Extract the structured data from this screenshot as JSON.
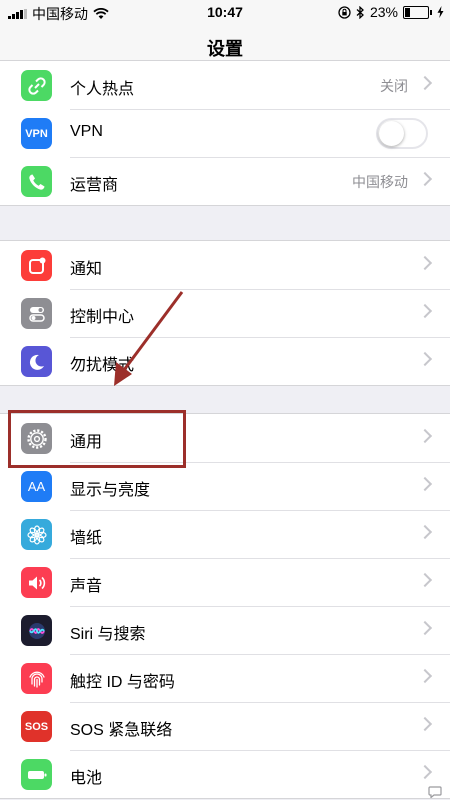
{
  "status_bar": {
    "carrier": "中国移动",
    "time": "10:47",
    "battery_percent": "23%",
    "battery_level": 0.23
  },
  "nav": {
    "title": "设置"
  },
  "group1": [
    {
      "label": "个人热点",
      "value": "关闭",
      "icon": "hotspot-icon",
      "color": "#4cd964"
    },
    {
      "label": "VPN",
      "icon": "vpn-icon",
      "icon_text": "VPN",
      "color": "#1f7cf6",
      "toggle_on": false
    },
    {
      "label": "运营商",
      "value": "中国移动",
      "icon": "phone-icon",
      "color": "#4cd964"
    }
  ],
  "group2": [
    {
      "label": "通知",
      "icon": "notification-icon",
      "color": "#fc3d39"
    },
    {
      "label": "控制中心",
      "icon": "control-center-icon",
      "color": "#8e8e93"
    },
    {
      "label": "勿扰模式",
      "icon": "moon-icon",
      "color": "#5856d6"
    }
  ],
  "group3": [
    {
      "label": "通用",
      "icon": "gear-icon",
      "color": "#8e8e93"
    },
    {
      "label": "显示与亮度",
      "icon": "display-icon",
      "icon_text": "AA",
      "color": "#1f7cf6"
    },
    {
      "label": "墙纸",
      "icon": "wallpaper-icon",
      "color": "#36aadc"
    },
    {
      "label": "声音",
      "icon": "sound-icon",
      "color": "#fc3d52"
    },
    {
      "label": "Siri 与搜索",
      "icon": "siri-icon",
      "color": "#1c1c2e"
    },
    {
      "label": "触控 ID 与密码",
      "icon": "fingerprint-icon",
      "color": "#fc3d52"
    },
    {
      "label": "SOS 紧急联络",
      "icon": "sos-icon",
      "icon_text": "SOS",
      "color": "#e0322a"
    },
    {
      "label": "电池",
      "icon": "battery-icon",
      "color": "#4cd964"
    }
  ],
  "annotation_color": "#9c2f2a"
}
